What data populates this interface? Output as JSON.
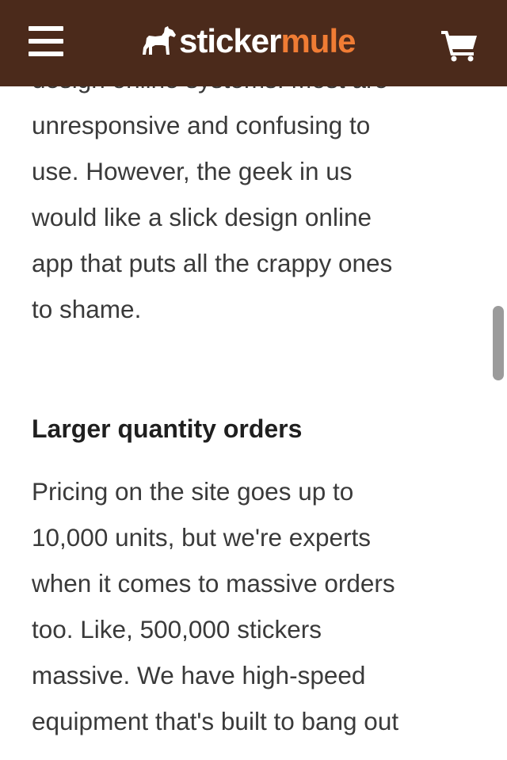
{
  "header": {
    "menu_icon": "hamburger-menu-icon",
    "logo": {
      "icon": "horse-icon",
      "text_part1": "sticker",
      "text_part2": "mule"
    },
    "cart_icon": "shopping-cart-icon"
  },
  "colors": {
    "header_background": "#4b2a1b",
    "logo_accent": "#f07c34",
    "body_text": "#3a3a3a",
    "heading_text": "#1f1f1f"
  },
  "article": {
    "paragraph_top": {
      "lines": [
        "design online systems. Most are",
        "unresponsive and confusing to",
        "use. However, the geek in us",
        "would like a slick design online",
        "app that puts all the crappy ones",
        "to shame."
      ]
    },
    "heading": "Larger quantity orders",
    "paragraph_bottom": {
      "lines": [
        "Pricing on the site goes up to",
        "10,000 units, but we're experts",
        "when it comes to massive orders",
        "too. Like, 500,000 stickers",
        "massive. We have high-speed",
        "equipment that's built to bang out"
      ]
    }
  }
}
